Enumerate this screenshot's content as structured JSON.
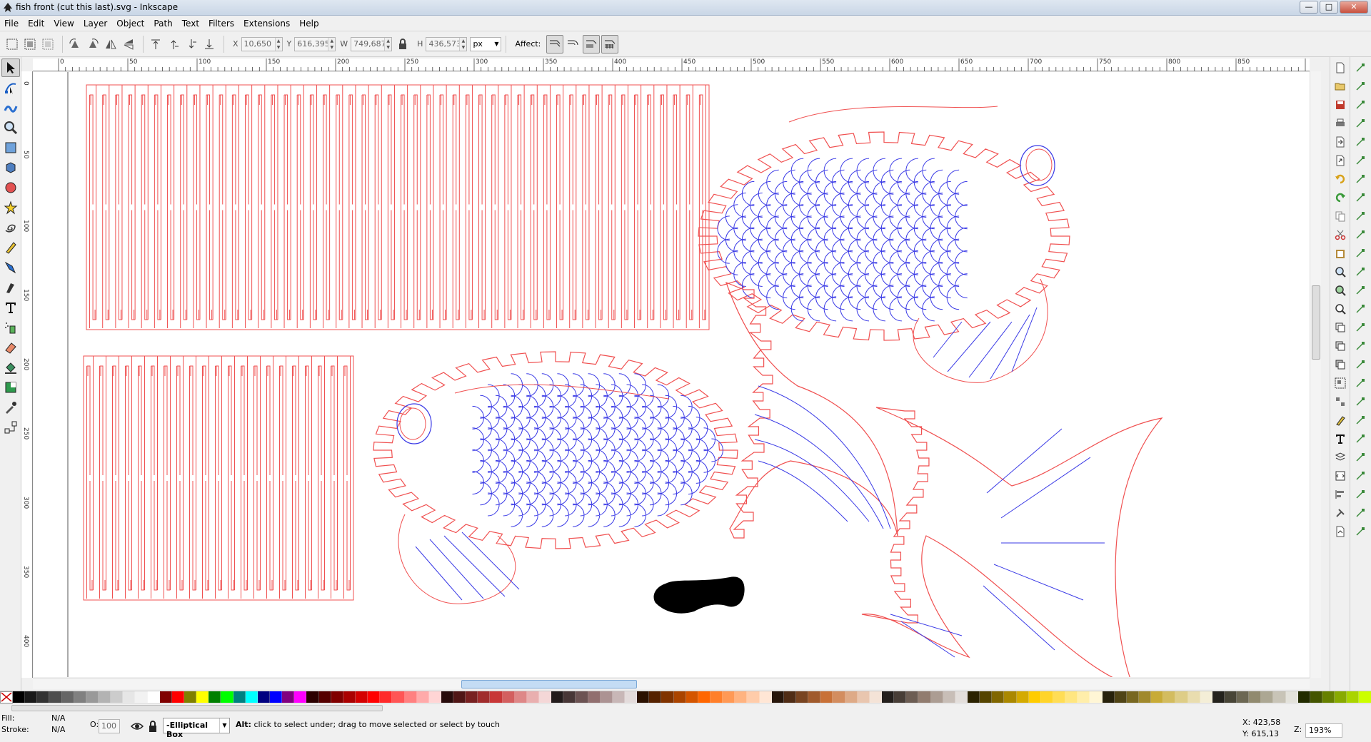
{
  "window": {
    "title": "fish front (cut this last).svg - Inkscape",
    "controls": {
      "minimize": "—",
      "maximize": "□",
      "close": "✕"
    }
  },
  "menu": [
    "File",
    "Edit",
    "View",
    "Layer",
    "Object",
    "Path",
    "Text",
    "Filters",
    "Extensions",
    "Help"
  ],
  "toolbar": {
    "x_label": "X",
    "x_value": "10,650",
    "y_label": "Y",
    "y_value": "616,395",
    "w_label": "W",
    "w_value": "749,687",
    "h_label": "H",
    "h_value": "436,573",
    "unit": "px",
    "affect_label": "Affect:"
  },
  "ruler": {
    "h_labels": [
      "0",
      "50",
      "100",
      "150",
      "200",
      "250",
      "300",
      "350",
      "400",
      "450",
      "500",
      "550",
      "600",
      "650",
      "700",
      "750",
      "800",
      "850"
    ],
    "v_labels": [
      "0",
      "50",
      "100",
      "150",
      "200",
      "250",
      "300",
      "350",
      "400"
    ]
  },
  "colors": {
    "cut_stroke": "#f05050",
    "engrave_stroke": "#3a3ae6",
    "fill_shape": "#000000",
    "canvas": "#ffffff"
  },
  "palette": [
    "#000000",
    "#1a1a1a",
    "#333333",
    "#4d4d4d",
    "#666666",
    "#808080",
    "#999999",
    "#b3b3b3",
    "#cccccc",
    "#e6e6e6",
    "#f2f2f2",
    "#ffffff",
    "#800000",
    "#ff0000",
    "#808000",
    "#ffff00",
    "#008000",
    "#00ff00",
    "#008080",
    "#00ffff",
    "#000080",
    "#0000ff",
    "#800080",
    "#ff00ff",
    "#2b0000",
    "#550000",
    "#800000",
    "#aa0000",
    "#d40000",
    "#ff0000",
    "#ff2a2a",
    "#ff5555",
    "#ff8080",
    "#ffaaaa",
    "#ffd5d5",
    "#280b0b",
    "#501616",
    "#782121",
    "#a02c2c",
    "#c83737",
    "#d35f5f",
    "#de8787",
    "#e9afaf",
    "#f4d7d7",
    "#241c1c",
    "#483737",
    "#6c5353",
    "#916f6f",
    "#ac9393",
    "#c8b7b7",
    "#e3dbdb",
    "#2b1100",
    "#552200",
    "#803300",
    "#aa4400",
    "#d45500",
    "#ff6600",
    "#ff7f2a",
    "#ff9955",
    "#ffb380",
    "#ffccaa",
    "#ffe6d5",
    "#28170b",
    "#502d16",
    "#784421",
    "#a05a2c",
    "#c87137",
    "#d38d5f",
    "#deaa87",
    "#e9c6af",
    "#f4e3d7",
    "#241f1c",
    "#483e37",
    "#6c5d53",
    "#917c6f",
    "#ac9d93",
    "#c8beb7",
    "#e3dedb",
    "#2b2200",
    "#554400",
    "#806600",
    "#aa8800",
    "#d4aa00",
    "#ffcc00",
    "#ffd42a",
    "#ffdd55",
    "#ffe680",
    "#ffeeaa",
    "#fff6d5",
    "#28220b",
    "#504416",
    "#786721",
    "#a0892c",
    "#c8ab37",
    "#d3bc5f",
    "#decd87",
    "#e9ddaf",
    "#f4eed7",
    "#24221c",
    "#484537",
    "#6c6753",
    "#918a6f",
    "#aca793",
    "#c8c4b7",
    "#e3e2db",
    "#222b00",
    "#445500",
    "#668000",
    "#88aa00",
    "#aad400",
    "#ccff00"
  ],
  "status": {
    "fill_label": "Fill:",
    "fill_value": "N/A",
    "stroke_label": "Stroke:",
    "stroke_value": "N/A",
    "opacity_label": "O:",
    "opacity_value": "100",
    "layer": "-Elliptical Box",
    "message_key": "Alt:",
    "message": " click to select under; drag to move selected or select by touch",
    "x_coord": "X:   423,58",
    "y_coord": "Y:   615,13",
    "zoom_label": "Z:",
    "zoom": "193%"
  }
}
